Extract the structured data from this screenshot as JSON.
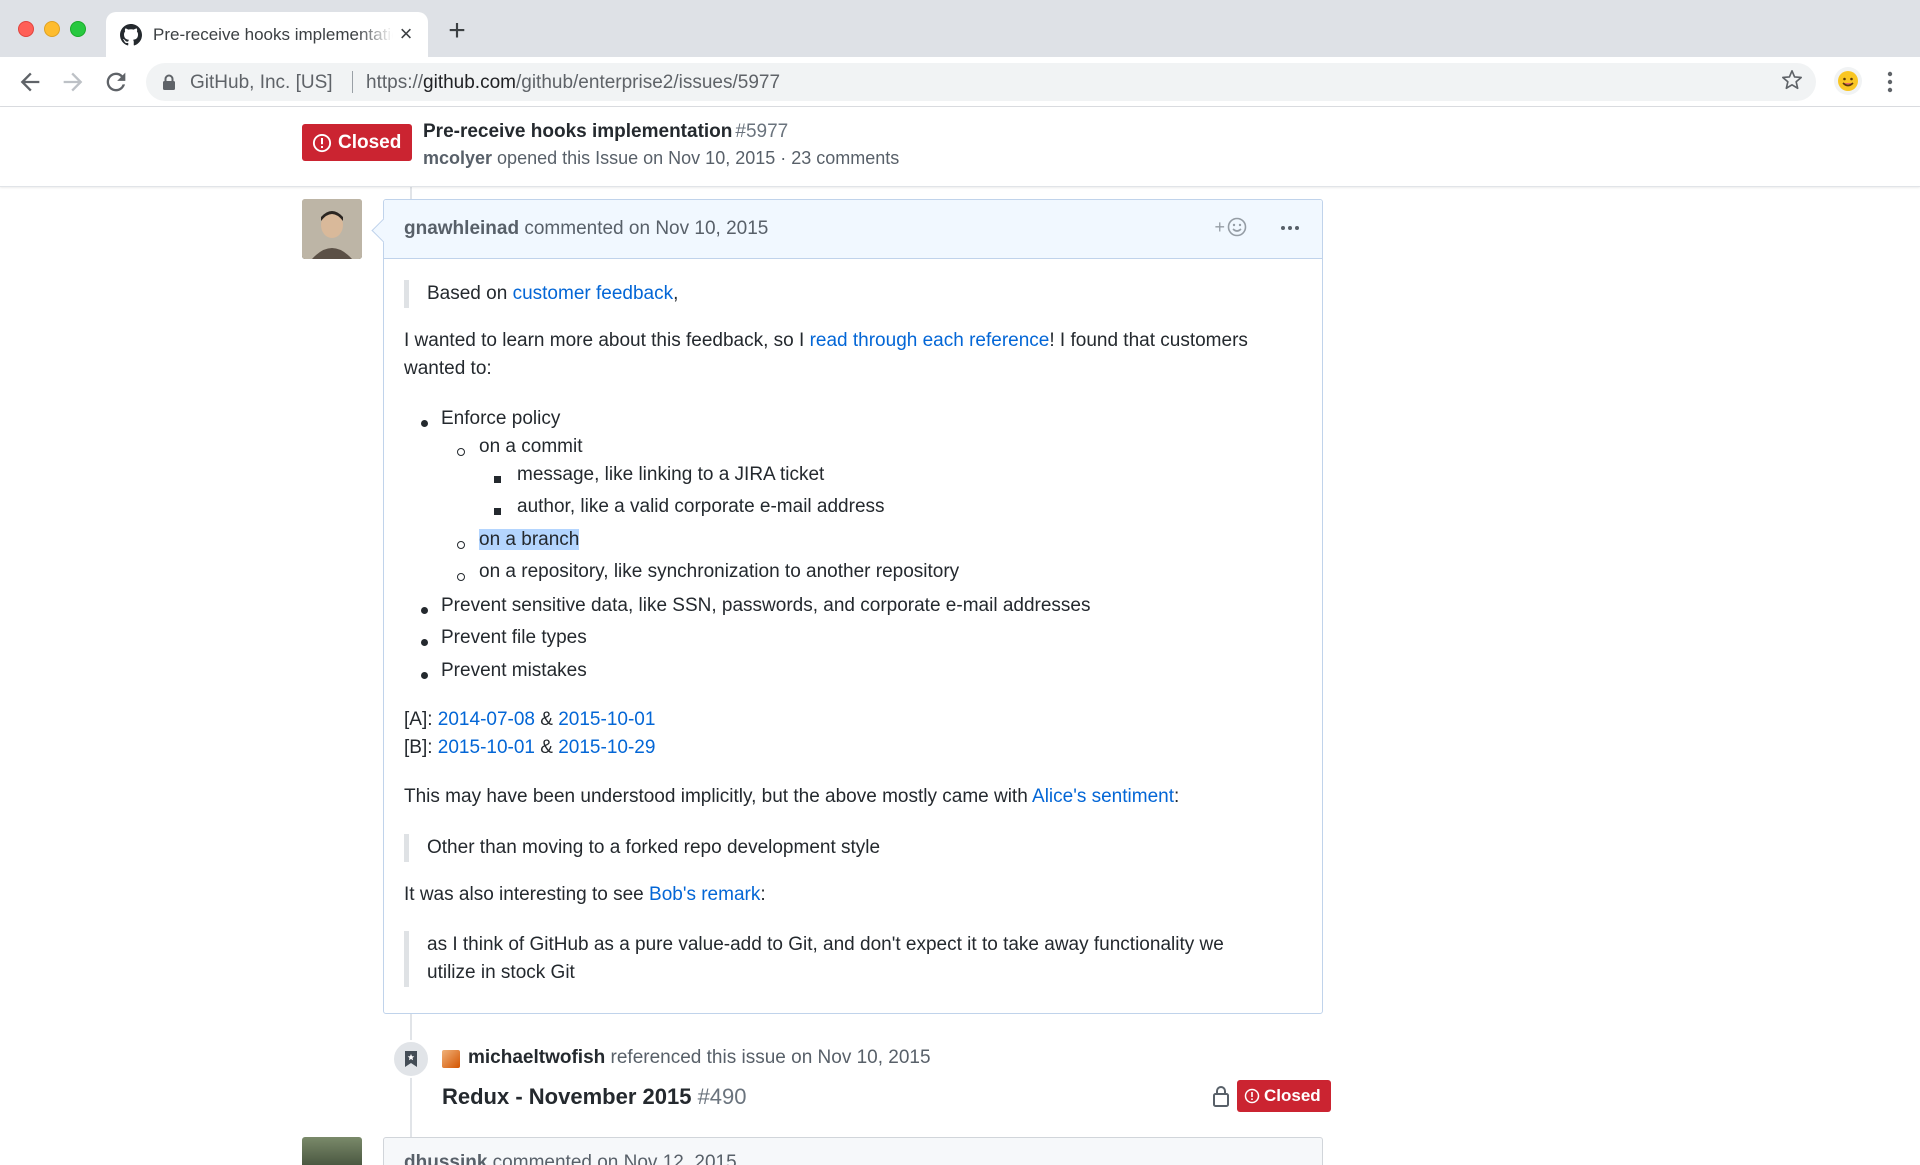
{
  "browser": {
    "tab_title": "Pre-receive hooks implementation",
    "site_identity": "GitHub, Inc. [US]",
    "url_scheme": "https://",
    "url_host": "github.com",
    "url_path": "/github/enterprise2/issues/5977"
  },
  "issue": {
    "state": "Closed",
    "title": "Pre-receive hooks implementation",
    "number": "#5977",
    "author": "mcolyer",
    "meta_rest": " opened this Issue on Nov 10, 2015 · 23 comments"
  },
  "comment": {
    "author": "gnawhleinad",
    "action": " commented on Nov 10, 2015",
    "reaction_plus": "+",
    "quote1_prefix": "Based on ",
    "quote1_link": "customer feedback",
    "quote1_suffix": ",",
    "para1_prefix": "I wanted to learn more about this feedback, so I ",
    "para1_link": "read through each reference",
    "para1_suffix": "! I found that customers",
    "para1_line2": "wanted to:",
    "list": {
      "l1": "Enforce policy",
      "l1a": "on a commit",
      "l1a_i": "message, like linking to a JIRA ticket",
      "l1a_ii": "author, like a valid corporate e-mail address",
      "l1b": "on a branch",
      "l1c": "on a repository, like synchronization to another repository",
      "l2": "Prevent sensitive data, like SSN, passwords, and corporate e-mail addresses",
      "l3": "Prevent file types",
      "l4": "Prevent mistakes"
    },
    "refs": {
      "a_label": "[A]: ",
      "a_link1": "2014-07-08",
      "amp": " & ",
      "a_link2": "2015-10-01",
      "b_label": "[B]: ",
      "b_link1": "2015-10-01",
      "b_link2": "2015-10-29"
    },
    "para2_prefix": "This may have been understood implicitly, but the above mostly came with ",
    "para2_link": "Alice's sentiment",
    "para2_suffix": ":",
    "quote2": "Other than moving to a forked repo development style",
    "para3_prefix": "It was also interesting to see ",
    "para3_link": "Bob's remark",
    "para3_suffix": ":",
    "quote3_line1": "as I think of GitHub as a pure value-add to Git, and don't expect it to take away functionality we",
    "quote3_line2": "utilize in stock Git"
  },
  "cross_reference": {
    "author": "michaeltwofish",
    "action": " referenced this issue on Nov 10, 2015",
    "title": "Redux - November 2015",
    "number": "#490",
    "state": "Closed"
  },
  "next_comment": {
    "author": "dhussink",
    "action": " commented on Nov 12, 2015"
  },
  "colors": {
    "closed_red": "#cb2431",
    "link_blue": "#0366d6",
    "comment_header_bg": "#f1f8ff",
    "selection": "#b4d5fe"
  }
}
